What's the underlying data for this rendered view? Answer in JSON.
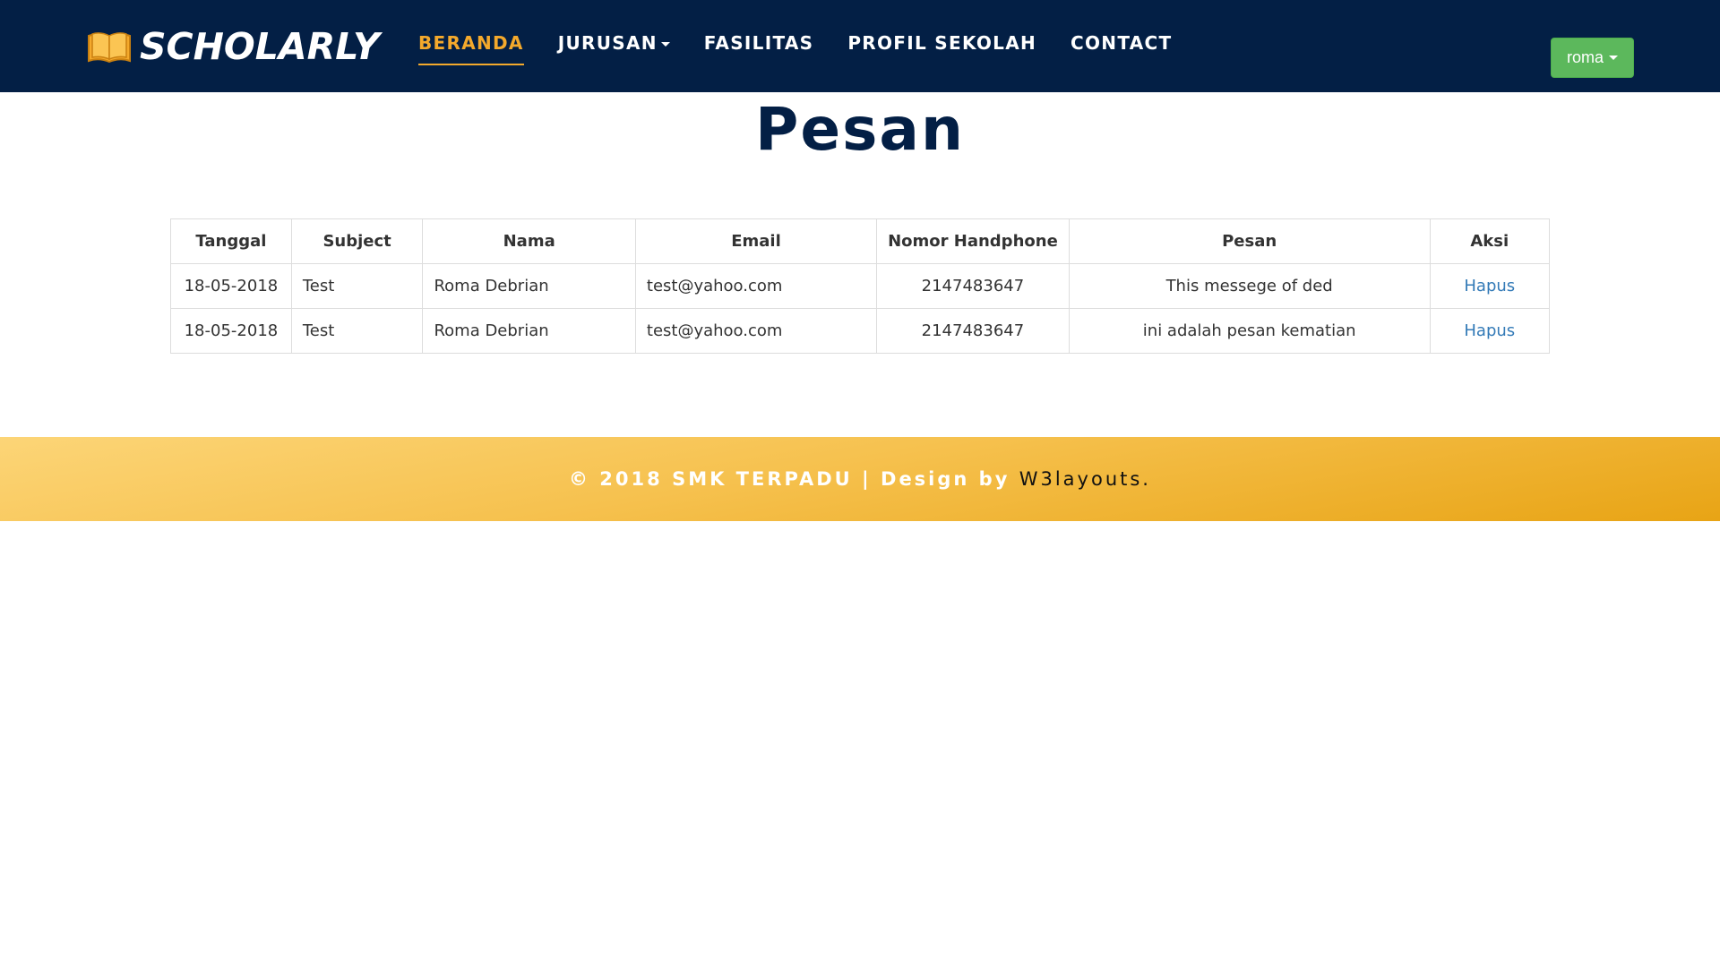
{
  "brand": {
    "name": "SCHOLARLY",
    "icon": "open-book-icon"
  },
  "nav": {
    "items": [
      {
        "label": "BERANDA",
        "active": true
      },
      {
        "label": "JURUSAN",
        "dropdown": true
      },
      {
        "label": "FASILITAS"
      },
      {
        "label": "PROFIL SEKOLAH"
      },
      {
        "label": "CONTACT"
      }
    ],
    "user_label": "roma"
  },
  "page": {
    "title": "Pesan"
  },
  "table": {
    "headers": [
      "Tanggal",
      "Subject",
      "Nama",
      "Email",
      "Nomor Handphone",
      "Pesan",
      "Aksi"
    ],
    "rows": [
      {
        "tanggal": "18-05-2018",
        "subject": "Test",
        "nama": "Roma Debrian",
        "email": "test@yahoo.com",
        "phone": "2147483647",
        "pesan": "This messege of ded",
        "aksi": "Hapus"
      },
      {
        "tanggal": "18-05-2018",
        "subject": "Test",
        "nama": "Roma Debrian",
        "email": "test@yahoo.com",
        "phone": "2147483647",
        "pesan": "ini adalah pesan kematian",
        "aksi": "Hapus"
      }
    ]
  },
  "footer": {
    "text": "© 2018 SMK TERPADU | Design by ",
    "link": "W3layouts."
  },
  "colors": {
    "navbar": "#031f45",
    "accent": "#f4a92c",
    "user_button": "#5cb85c",
    "link": "#337ab7",
    "footer": "#f6c14e"
  }
}
